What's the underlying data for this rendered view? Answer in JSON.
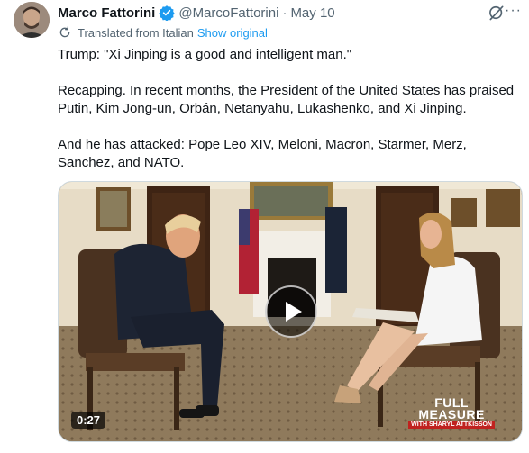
{
  "tweet": {
    "author_name": "Marco Fattorini",
    "handle": "@MarcoFattorini",
    "separator": "·",
    "date": "May 10",
    "more_label": "···",
    "translated_label": "Translated from Italian",
    "show_original_label": "Show original",
    "lines": [
      "Trump: \"Xi Jinping is a good and intelligent man.\"",
      "Recapping. In recent months, the President of the United States has praised Putin, Kim Jong-un, Orbán, Netanyahu, Lukashenko, and Xi Jinping.",
      "And he has attacked: Pope Leo XIV, Meloni, Macron, Starmer, Merz, Sanchez, and NATO."
    ]
  },
  "media": {
    "duration": "0:27",
    "overlay_logo": [
      "FULL",
      "MEASURE",
      "WITH SHARYL ATTKISSON"
    ],
    "play_icon": "play-icon"
  },
  "colors": {
    "accent": "#1d9bf0",
    "muted": "#536471",
    "text": "#0f1419"
  }
}
